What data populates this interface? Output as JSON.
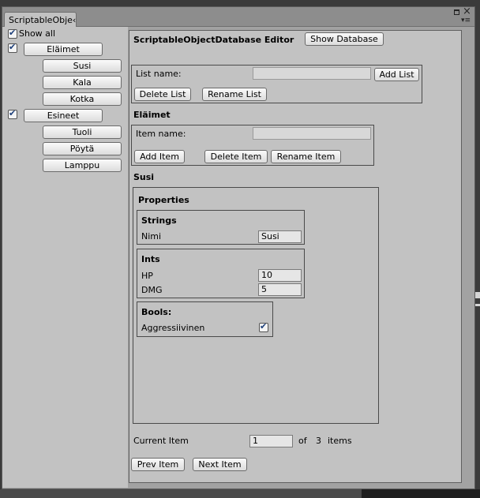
{
  "window": {
    "tab_label": "ScriptableObje‹",
    "max_icon": "maximize-icon",
    "close_icon": "close-icon",
    "menu_icon": "context-menu-icon"
  },
  "tree": {
    "show_all_label": "Show all",
    "show_all_checked": true,
    "groups": [
      {
        "label": "Eläimet",
        "checked": true,
        "items": [
          "Susi",
          "Kala",
          "Kotka"
        ]
      },
      {
        "label": "Esineet",
        "checked": true,
        "items": [
          "Tuoli",
          "Pöytä",
          "Lamppu"
        ]
      }
    ]
  },
  "editor": {
    "title": "ScriptableObjectDatabase Editor",
    "show_database_label": "Show Database",
    "list_name_label": "List name:",
    "list_name_value": "",
    "add_list_label": "Add List",
    "delete_list_label": "Delete List",
    "rename_list_label": "Rename List",
    "current_list_title": "Eläimet",
    "item_name_label": "Item name:",
    "item_name_value": "",
    "add_item_label": "Add Item",
    "delete_item_label": "Delete Item",
    "rename_item_label": "Rename Item",
    "current_item_title": "Susi",
    "properties": {
      "title": "Properties",
      "strings_title": "Strings",
      "strings": [
        {
          "label": "Nimi",
          "value": "Susi"
        }
      ],
      "ints_title": "Ints",
      "ints": [
        {
          "label": "HP",
          "value": "10"
        },
        {
          "label": "DMG",
          "value": "5"
        }
      ],
      "bools_title": "Bools:",
      "bools": [
        {
          "label": "Aggressiivinen",
          "checked": true
        }
      ]
    },
    "nav": {
      "current_item_label": "Current Item",
      "current_item_value": "1",
      "of_label": "of",
      "total": "3",
      "items_label": "items",
      "prev_label": "Prev Item",
      "next_label": "Next Item"
    }
  }
}
